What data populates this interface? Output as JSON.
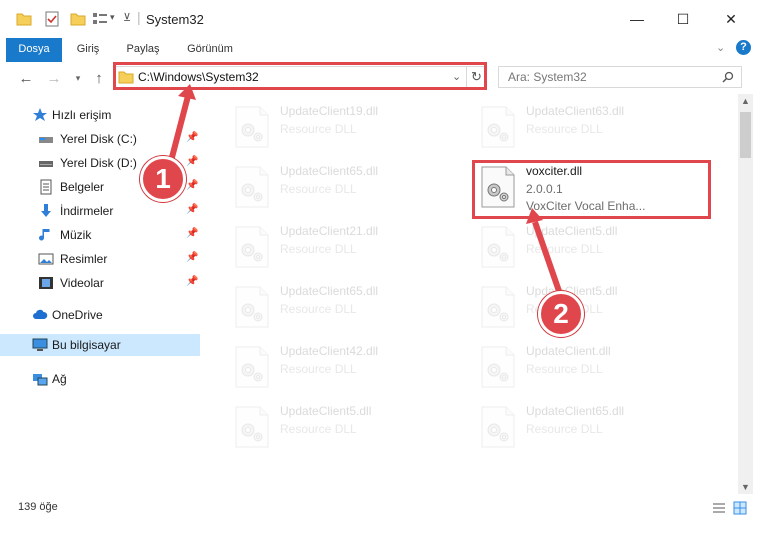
{
  "window": {
    "title": "System32",
    "minimize": "—",
    "maximize": "☐",
    "close": "✕"
  },
  "ribbon": {
    "tabs": [
      "Dosya",
      "Giriş",
      "Paylaş",
      "Görünüm"
    ],
    "help": "?"
  },
  "address": {
    "path": "C:\\Windows\\System32",
    "search_placeholder": "Ara: System32"
  },
  "sidebar": {
    "items": [
      {
        "label": "Hızlı erişim",
        "icon": "star-icon"
      },
      {
        "label": "Yerel Disk (C:)",
        "icon": "drive-icon"
      },
      {
        "label": "Yerel Disk (D:)",
        "icon": "drive-icon"
      },
      {
        "label": "Belgeler",
        "icon": "documents-icon"
      },
      {
        "label": "İndirmeler",
        "icon": "download-icon"
      },
      {
        "label": "Müzik",
        "icon": "music-icon"
      },
      {
        "label": "Resimler",
        "icon": "pictures-icon"
      },
      {
        "label": "Videolar",
        "icon": "video-icon"
      },
      {
        "label": "OneDrive",
        "icon": "cloud-icon"
      },
      {
        "label": "Bu bilgisayar",
        "icon": "computer-icon"
      },
      {
        "label": "Ağ",
        "icon": "network-icon"
      }
    ]
  },
  "files": [
    {
      "name": "UpdateClient19.dll",
      "type": "Resource DLL"
    },
    {
      "name": "UpdateClient63.dll",
      "type": "Resource DLL"
    },
    {
      "name": "UpdateClient65.dll",
      "type": "Resource DLL"
    },
    {
      "name": "voxciter.dll",
      "version": "2.0.0.1",
      "desc": "VoxCiter Vocal Enha..."
    },
    {
      "name": "UpdateClient21.dll",
      "type": "Resource DLL"
    },
    {
      "name": "UpdateClient5.dll",
      "type": "Resource DLL"
    },
    {
      "name": "UpdateClient65.dll",
      "type": "Resource DLL"
    },
    {
      "name": "UpdateClient5.dll",
      "type": "Resource DLL"
    },
    {
      "name": "UpdateClient42.dll",
      "type": "Resource DLL"
    },
    {
      "name": "UpdateClient.dll",
      "type": "Resource DLL"
    },
    {
      "name": "UpdateClient5.dll",
      "type": "Resource DLL"
    },
    {
      "name": "UpdateClient65.dll",
      "type": "Resource DLL"
    }
  ],
  "status": {
    "count": "139 öğe"
  },
  "annotations": {
    "step1": "1",
    "step2": "2",
    "color": "#e0474c"
  }
}
